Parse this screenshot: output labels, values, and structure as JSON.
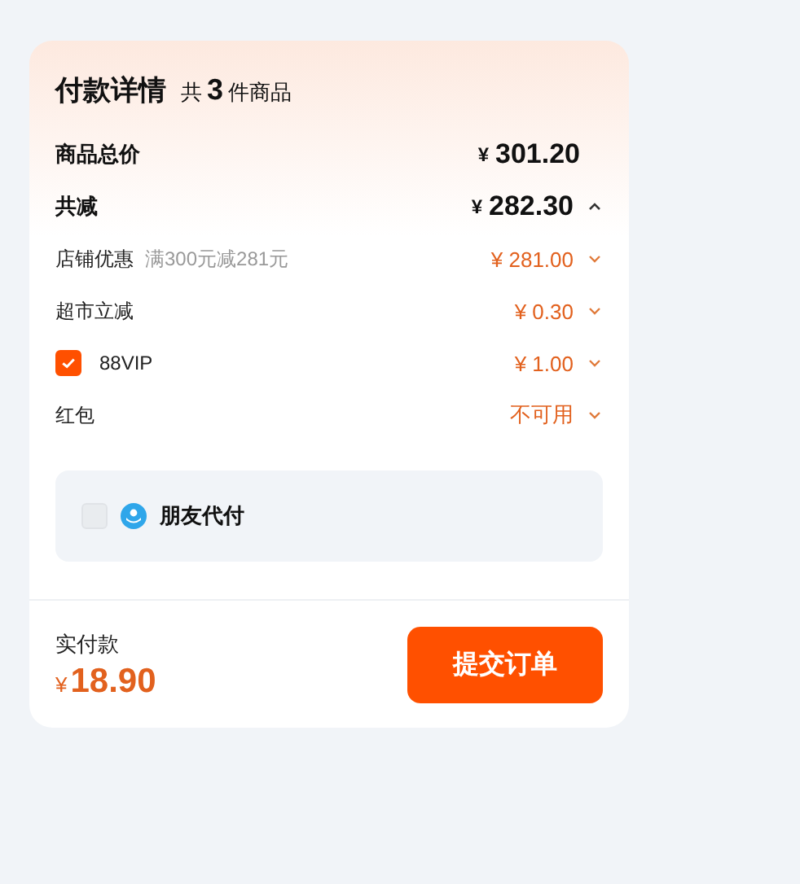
{
  "header": {
    "title": "付款详情",
    "count_prefix": "共",
    "count": "3",
    "count_suffix": "件商品"
  },
  "subtotal": {
    "label": "商品总价",
    "currency": "¥",
    "amount": "301.20"
  },
  "discount_total": {
    "label": "共减",
    "currency": "¥",
    "amount": "282.30",
    "expanded": true
  },
  "discounts": [
    {
      "kind": "plain",
      "label": "店铺优惠",
      "note": "满300元减281元",
      "value": "¥ 281.00"
    },
    {
      "kind": "plain",
      "label": "超市立减",
      "value": "¥ 0.30"
    },
    {
      "kind": "checkbox",
      "checked": true,
      "label": "88VIP",
      "value": "¥ 1.00"
    },
    {
      "kind": "plain",
      "label": "红包",
      "value": "不可用"
    }
  ],
  "friend_pay": {
    "checked": false,
    "label": "朋友代付"
  },
  "footer": {
    "label": "实付款",
    "currency": "¥",
    "amount": "18.90",
    "submit": "提交订单"
  }
}
